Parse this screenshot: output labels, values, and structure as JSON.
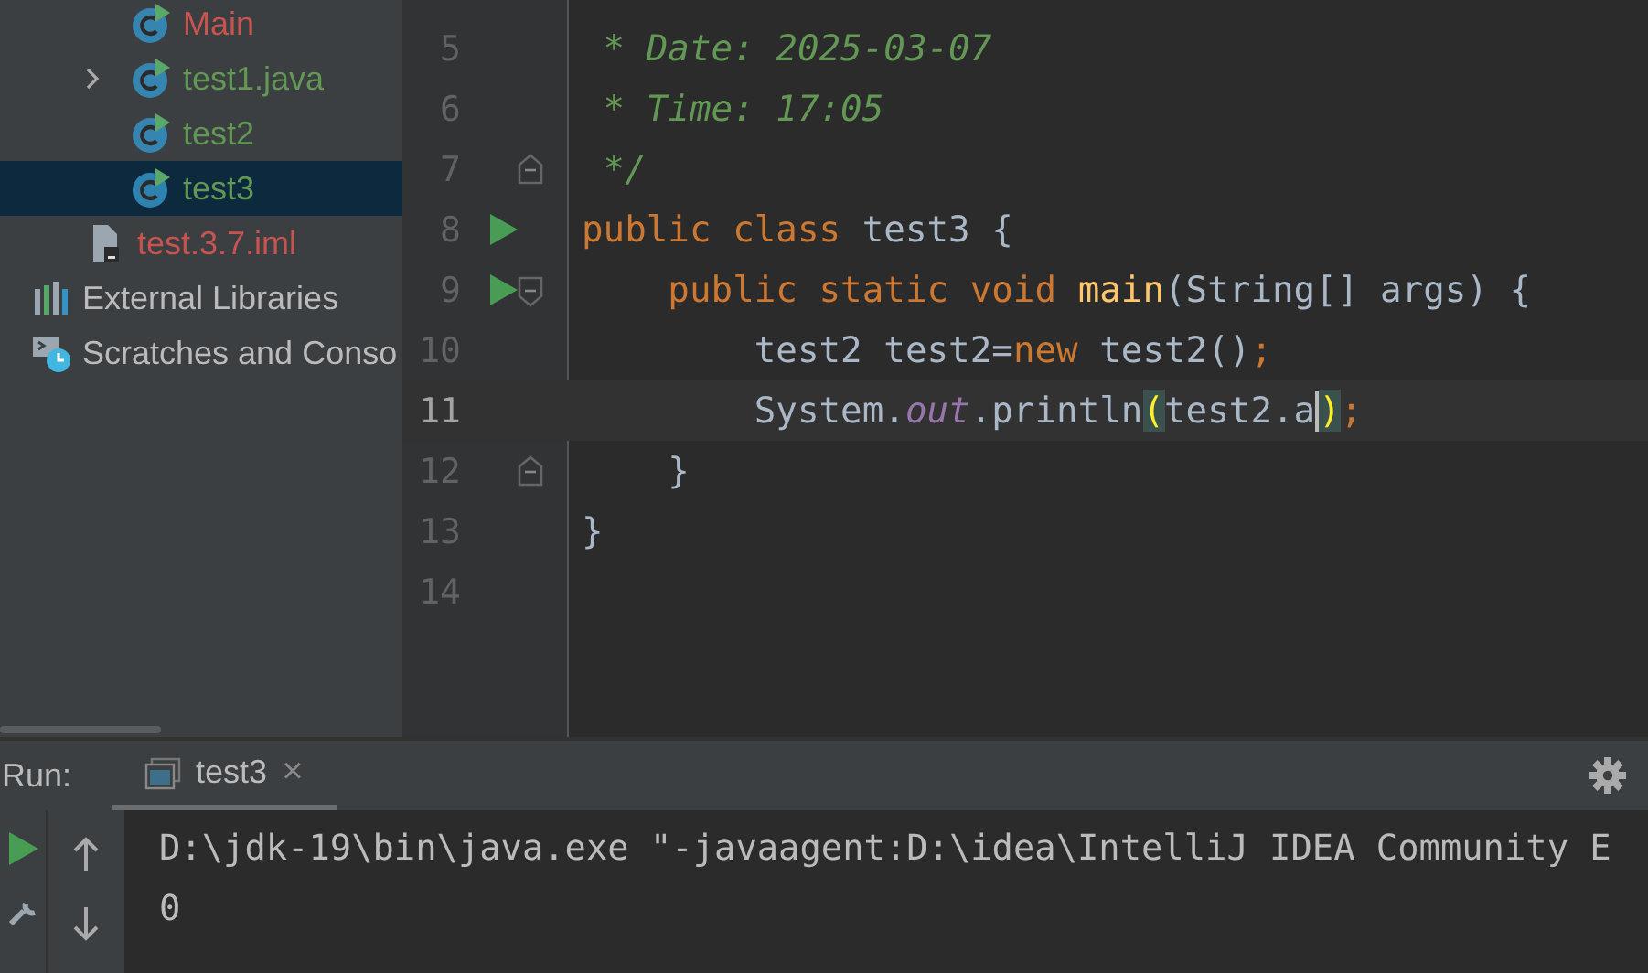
{
  "project_tree": {
    "items": [
      {
        "label": "Main",
        "kind": "class",
        "color": "#c75450",
        "selected": false
      },
      {
        "label": "test1.java",
        "kind": "class",
        "color": "#629755",
        "expanded": false,
        "selected": false
      },
      {
        "label": "test2",
        "kind": "class",
        "color": "#629755",
        "selected": false
      },
      {
        "label": "test3",
        "kind": "class",
        "color": "#629755",
        "selected": true
      },
      {
        "label": "test.3.7.iml",
        "kind": "file",
        "color": "#c75450",
        "selected": false
      },
      {
        "label": "External Libraries",
        "kind": "libraries",
        "color": "#bbbbbb",
        "selected": false
      },
      {
        "label": "Scratches and Conso",
        "kind": "scratches",
        "color": "#bbbbbb",
        "selected": false
      }
    ]
  },
  "editor": {
    "lines": [
      {
        "number": "5",
        "run": false,
        "fold_start": false,
        "fold_end": false,
        "current": false,
        "tokens": [
          {
            "text": " * Date: 2025-03-07",
            "kind": "comment"
          }
        ]
      },
      {
        "number": "6",
        "run": false,
        "fold_start": false,
        "fold_end": false,
        "current": false,
        "tokens": [
          {
            "text": " * Time: 17:05",
            "kind": "comment"
          }
        ]
      },
      {
        "number": "7",
        "run": false,
        "fold_start": false,
        "fold_end": true,
        "current": false,
        "tokens": [
          {
            "text": " */",
            "kind": "comment"
          }
        ]
      },
      {
        "number": "8",
        "run": true,
        "fold_start": false,
        "fold_end": false,
        "current": false,
        "tokens": [
          {
            "text": "public class ",
            "kind": "keyword"
          },
          {
            "text": "test3 {",
            "kind": "plain"
          }
        ]
      },
      {
        "number": "9",
        "run": true,
        "fold_start": true,
        "fold_end": false,
        "current": false,
        "tokens": [
          {
            "text": "    public static void ",
            "kind": "keyword"
          },
          {
            "text": "main",
            "kind": "method"
          },
          {
            "text": "(String[] args) {",
            "kind": "plain"
          }
        ]
      },
      {
        "number": "10",
        "run": false,
        "fold_start": false,
        "fold_end": false,
        "current": false,
        "tokens": [
          {
            "text": "        test2 test2=",
            "kind": "plain"
          },
          {
            "text": "new ",
            "kind": "keyword"
          },
          {
            "text": "test2()",
            "kind": "plain"
          },
          {
            "text": ";",
            "kind": "keyword"
          }
        ]
      },
      {
        "number": "11",
        "run": false,
        "fold_start": false,
        "fold_end": false,
        "current": true,
        "tokens": [
          {
            "text": "        System.",
            "kind": "plain"
          },
          {
            "text": "out",
            "kind": "field"
          },
          {
            "text": ".println",
            "kind": "plain"
          },
          {
            "text": "(",
            "kind": "paren-match"
          },
          {
            "text": "test2.a",
            "kind": "plain",
            "caret": true
          },
          {
            "text": ")",
            "kind": "paren-match"
          },
          {
            "text": ";",
            "kind": "keyword"
          }
        ]
      },
      {
        "number": "12",
        "run": false,
        "fold_start": false,
        "fold_end": true,
        "current": false,
        "tokens": [
          {
            "text": "    }",
            "kind": "plain"
          }
        ]
      },
      {
        "number": "13",
        "run": false,
        "fold_start": false,
        "fold_end": false,
        "current": false,
        "tokens": [
          {
            "text": "}",
            "kind": "plain"
          }
        ]
      },
      {
        "number": "14",
        "run": false,
        "fold_start": false,
        "fold_end": false,
        "current": false
      }
    ]
  },
  "run_panel": {
    "label": "Run:",
    "tabs": [
      {
        "label": "test3",
        "close": "×",
        "selected": true
      }
    ],
    "console": [
      "D:\\jdk-19\\bin\\java.exe \"-javaagent:D:\\idea\\IntelliJ IDEA Community E",
      "0"
    ]
  }
}
